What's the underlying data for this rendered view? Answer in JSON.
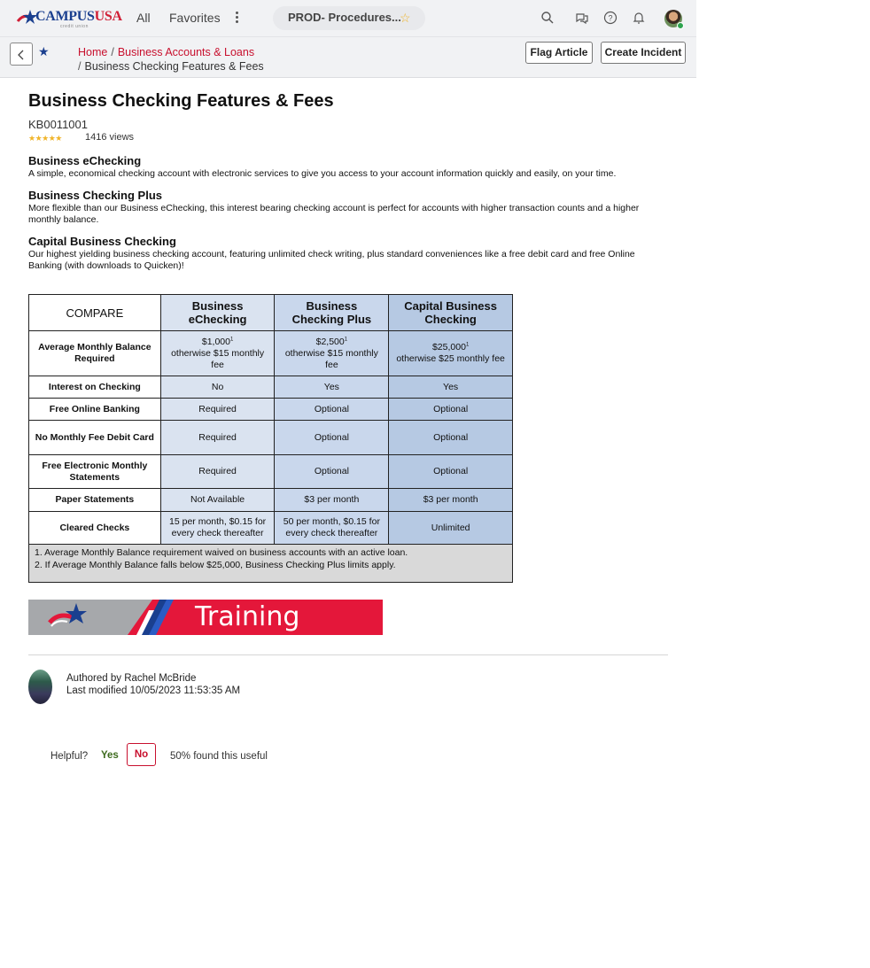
{
  "topnav": {
    "logo_text_1": "CAMPUS",
    "logo_text_2": "USA",
    "logo_tagline": "credit union",
    "all": "All",
    "favorites": "Favorites",
    "tab_title": "PROD- Procedures...",
    "icons": [
      "search-icon",
      "chat-icon",
      "help-icon",
      "bell-icon"
    ]
  },
  "subheader": {
    "breadcrumb_1": "Home",
    "breadcrumb_2": "Business Accounts & Loans",
    "breadcrumb_3": "Business Checking Features & Fees",
    "sep": "/",
    "flag_article": "Flag Article",
    "create_incident": "Create Incident"
  },
  "article": {
    "title": "Business Checking Features & Fees",
    "kb_number": "KB0011001",
    "rating_stars": "★★★★★",
    "views": "1416 views",
    "sections": [
      {
        "heading": "Business eChecking",
        "text": "A simple, economical checking account with electronic services to give you access to your account information quickly and easily, on your time."
      },
      {
        "heading": "Business Checking Plus",
        "text": "More flexible than our Business eChecking, this interest bearing checking account is perfect for accounts with higher transaction counts and a higher monthly balance."
      },
      {
        "heading": "Capital Business Checking",
        "text": "Our highest yielding business checking account, featuring unlimited check writing, plus standard conveniences like a free debit card and free Online Banking (with downloads to Quicken)!"
      }
    ]
  },
  "compare_table": {
    "headers": [
      "COMPARE",
      "Business eChecking",
      "Business Checking Plus",
      "Capital Business Checking"
    ],
    "rows": [
      {
        "label": "Average Monthly Balance Required",
        "cells": [
          {
            "main": "$1,000",
            "sup": "1",
            "sub": "otherwise $15 monthly fee"
          },
          {
            "main": "$2,500",
            "sup": "1",
            "sub": "otherwise $15 monthly fee"
          },
          {
            "main": "$25,000",
            "sup": "1",
            "sub": "otherwise $25 monthly fee"
          }
        ]
      },
      {
        "label": "Interest on Checking",
        "values": [
          "No",
          "Yes",
          "Yes"
        ]
      },
      {
        "label": "Free Online Banking",
        "values": [
          "Required",
          "Optional",
          "Optional"
        ]
      },
      {
        "label": "No Monthly Fee Debit Card",
        "values": [
          "Required",
          "Optional",
          "Optional"
        ]
      },
      {
        "label": "Free Electronic Monthly Statements",
        "values": [
          "Required",
          "Optional",
          "Optional"
        ]
      },
      {
        "label": "Paper Statements",
        "values": [
          "Not Available",
          "$3 per month",
          "$3 per month"
        ]
      },
      {
        "label": "Cleared Checks",
        "values": [
          "15 per month, $0.15 for every check thereafter",
          "50 per month, $0.15 for every check thereafter",
          "Unlimited"
        ]
      }
    ],
    "footnotes": [
      "1. Average Monthly Balance requirement waived on business accounts with an active loan.",
      "2. If Average Monthly Balance falls below $25,000, Business Checking Plus limits apply."
    ]
  },
  "banner": {
    "text": "Training"
  },
  "author": {
    "authored_by": "Authored by Rachel McBride",
    "last_modified": "Last modified 10/05/2023 11:53:35 AM"
  },
  "feedback": {
    "helpful": "Helpful?",
    "yes": "Yes",
    "no": "No",
    "useful": "50% found this useful"
  },
  "colors": {
    "brand_blue": "#1a3f8f",
    "brand_red": "#c8102e",
    "col1": "#dae3f0",
    "col2": "#c9d7ec",
    "col3": "#b6c9e3"
  }
}
